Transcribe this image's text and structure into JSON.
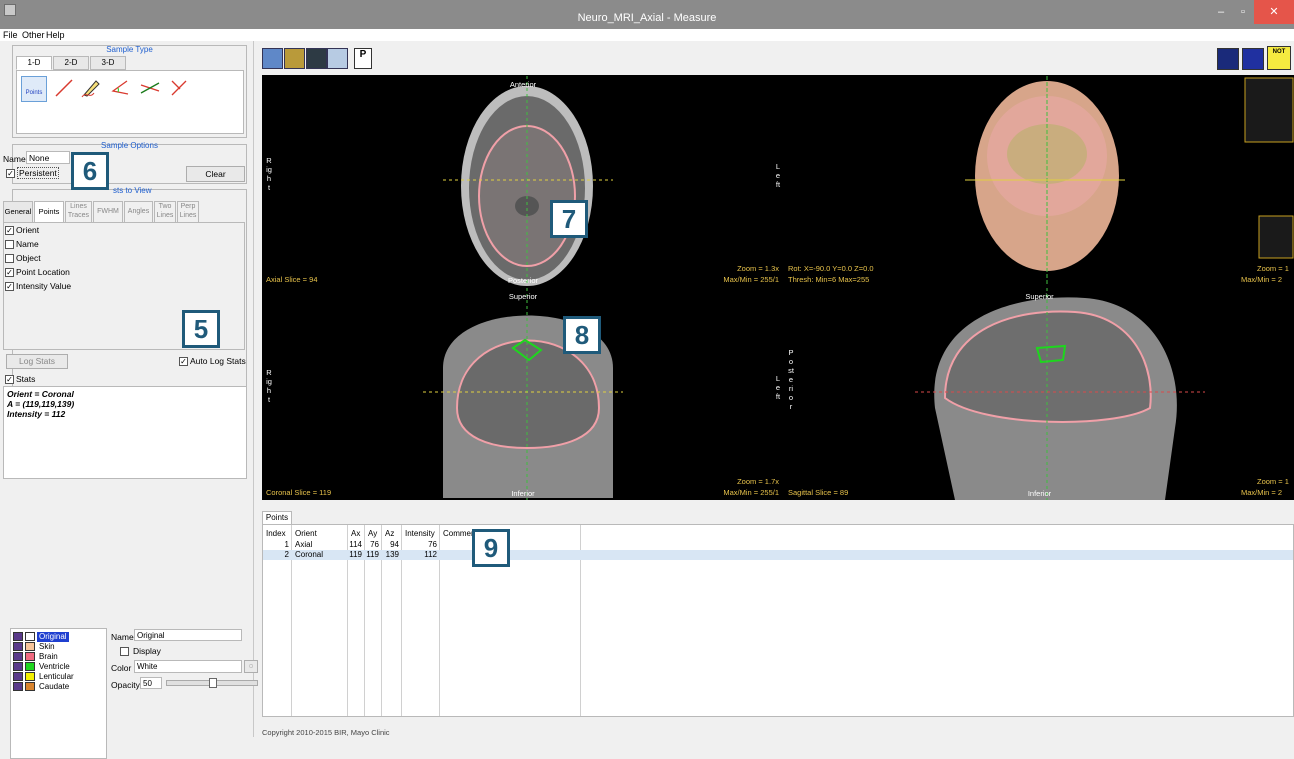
{
  "window": {
    "title": "Neuro_MRI_Axial - Measure",
    "minimize": "–",
    "restore": "▫",
    "close": "✕"
  },
  "menu": [
    "File",
    "Other",
    "Help"
  ],
  "sample_type": {
    "title": "Sample Type",
    "tabs": [
      "1-D",
      "2-D",
      "3-D"
    ],
    "active_tab": "1-D",
    "tools": [
      {
        "name": "points-tool-icon",
        "label": "Points"
      },
      {
        "name": "line-tool-icon"
      },
      {
        "name": "trace-tool-icon"
      },
      {
        "name": "angle-tool-icon"
      },
      {
        "name": "two-lines-tool-icon"
      },
      {
        "name": "perp-lines-tool-icon"
      }
    ]
  },
  "sample_options": {
    "title": "Sample Options",
    "name_label": "Name",
    "name_value": "None",
    "persistent_label": "Persistent",
    "persistent_checked": true,
    "clear_label": "Clear"
  },
  "stats_to_view": {
    "title": "sts to View",
    "tabs": [
      "General",
      "Points",
      "Lines Traces",
      "FWHM",
      "Angles",
      "Two Lines",
      "Perp Lines"
    ],
    "active_tab": "Points",
    "checkboxes": [
      {
        "label": "Orient",
        "checked": true
      },
      {
        "label": "Name",
        "checked": false
      },
      {
        "label": "Object",
        "checked": false
      },
      {
        "label": "Point Location",
        "checked": true
      },
      {
        "label": "Intensity Value",
        "checked": true
      }
    ],
    "log_stats_label": "Log Stats",
    "auto_log_label": "Auto Log Stats",
    "auto_log_checked": true
  },
  "stats": {
    "label": "Stats",
    "checked": true,
    "lines": [
      "Orient = Coronal",
      "A = (119,119,139)",
      "Intensity = 112"
    ]
  },
  "objects": [
    {
      "name": "Original",
      "color": "#ffffff",
      "selected": true
    },
    {
      "name": "Skin",
      "color": "#f6c49a",
      "selected": false
    },
    {
      "name": "Brain",
      "color": "#f06a80",
      "selected": false
    },
    {
      "name": "Ventricle",
      "color": "#1ed61e",
      "selected": false
    },
    {
      "name": "Lenticular",
      "color": "#f4f000",
      "selected": false
    },
    {
      "name": "Caudate",
      "color": "#d9842e",
      "selected": false
    }
  ],
  "object_props": {
    "name_label": "Name",
    "name_value": "Original",
    "display_label": "Display",
    "display_checked": false,
    "color_label": "Color",
    "color_value": "White",
    "opacity_label": "Opacity",
    "opacity_value": "50",
    "opacity_fraction": 0.5
  },
  "toolbar": {
    "left_icons": [
      "colour-data-icon",
      "object-map-icon",
      "render-icon",
      "point-label-icon"
    ],
    "right_icons": [
      "layout-icon",
      "display-icon",
      "notes-icon"
    ],
    "point_label_glyph": "P",
    "notes_glyph": "NOT"
  },
  "views": {
    "axial": {
      "top": "Anterior",
      "bottom": "Posterior",
      "left": "Right",
      "right": "Left",
      "slice": "Axial Slice = 94",
      "zoom": "Zoom = 1.3x",
      "maxmin": "Max/Min = 255/1"
    },
    "render": {
      "rot": "Rot: X=-90.0 Y=0.0 Z=0.0",
      "thresh": "Thresh: Min=6 Max=255",
      "zoom": "Zoom = 1",
      "maxmin": "Max/Min = 2"
    },
    "coronal": {
      "top": "Superior",
      "bottom": "Inferior",
      "left": "Right",
      "right": "Left",
      "slice": "Coronal Slice = 119",
      "zoom": "Zoom = 1.7x",
      "maxmin": "Max/Min = 255/1"
    },
    "sagittal": {
      "top": "Superior",
      "bottom": "Inferior",
      "left": "Posterior",
      "slice": "Sagittal Slice = 89",
      "zoom": "Zoom = 1",
      "maxmin": "Max/Min = 2"
    }
  },
  "points_table": {
    "tab": "Points",
    "columns": [
      "Index",
      "Orient",
      "Ax",
      "Ay",
      "Az",
      "Intensity",
      "Comment"
    ],
    "rows": [
      [
        "1",
        "Axial",
        "114",
        "76",
        "94",
        "76",
        ""
      ],
      [
        "2",
        "Coronal",
        "119",
        "119",
        "139",
        "112",
        ""
      ]
    ]
  },
  "callouts": [
    "5",
    "6",
    "7",
    "8",
    "9"
  ],
  "footer": "Copyright 2010-2015  BIR, Mayo Clinic"
}
